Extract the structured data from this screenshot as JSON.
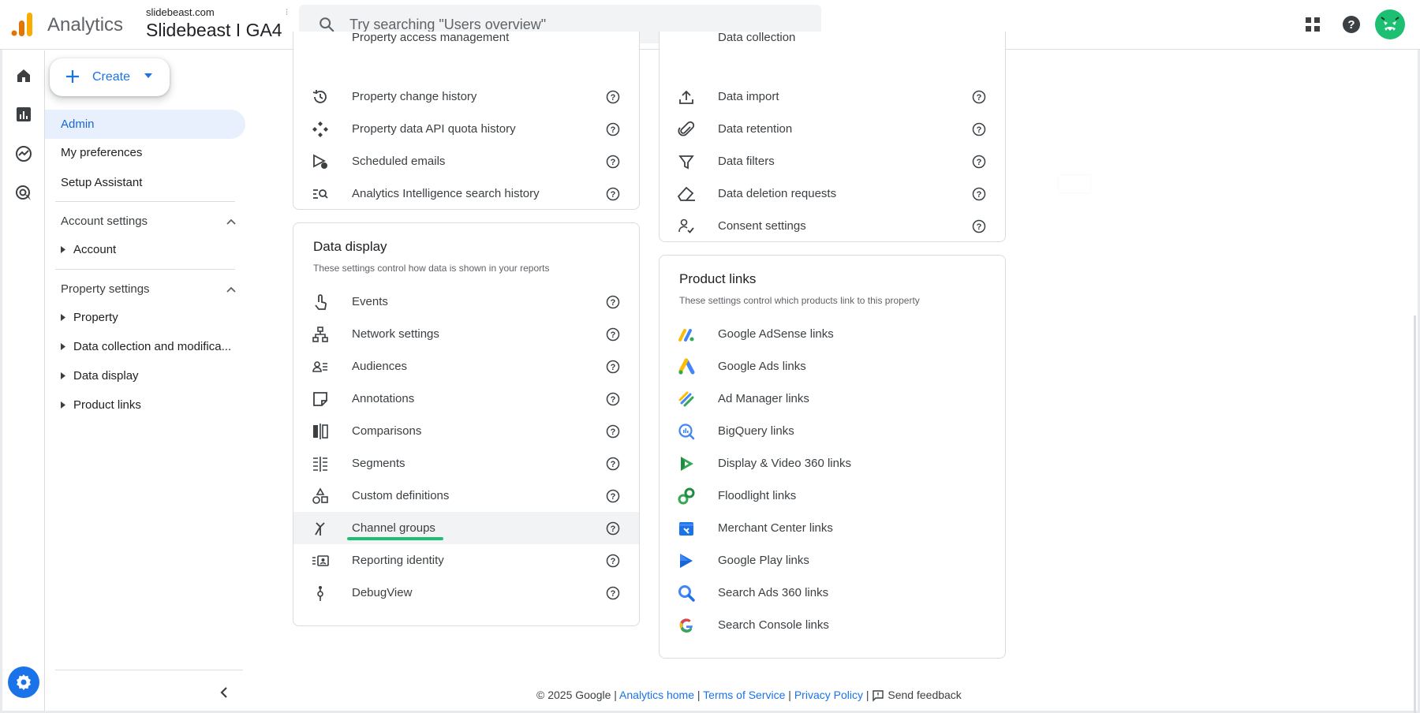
{
  "header": {
    "app_name": "Analytics",
    "account_domain": "slidebeast.com",
    "property_name": "Slidebeast I GA4",
    "search_placeholder": "Try searching \"Users overview\""
  },
  "colors": {
    "accent": "#1a73e8",
    "avatar": "#1dbf73",
    "highlight_underline": "#1dbf73"
  },
  "rail": {
    "items": [
      "home-icon",
      "reports-icon",
      "explore-icon",
      "advertising-icon"
    ],
    "admin": "gear-icon"
  },
  "nav": {
    "create_label": "Create",
    "items": [
      {
        "label": "Admin",
        "active": true
      },
      {
        "label": "My preferences",
        "active": false
      },
      {
        "label": "Setup Assistant",
        "active": false
      }
    ],
    "account_settings": {
      "title": "Account settings",
      "children": [
        "Account"
      ]
    },
    "property_settings": {
      "title": "Property settings",
      "children": [
        "Property",
        "Data collection and modifica...",
        "Data display",
        "Product links"
      ]
    }
  },
  "property_card": {
    "partial_top": "Property access management",
    "rows": [
      {
        "label": "Property change history",
        "icon": "history-icon"
      },
      {
        "label": "Property data API quota history",
        "icon": "api-quota-icon"
      },
      {
        "label": "Scheduled emails",
        "icon": "scheduled-email-icon"
      },
      {
        "label": "Analytics Intelligence search history",
        "icon": "search-history-icon"
      }
    ]
  },
  "data_display_card": {
    "title": "Data display",
    "subtitle": "These settings control how data is shown in your reports",
    "rows": [
      {
        "label": "Events",
        "icon": "touch-icon"
      },
      {
        "label": "Network settings",
        "icon": "network-icon"
      },
      {
        "label": "Audiences",
        "icon": "audiences-icon"
      },
      {
        "label": "Annotations",
        "icon": "annotation-icon"
      },
      {
        "label": "Comparisons",
        "icon": "comparison-icon"
      },
      {
        "label": "Segments",
        "icon": "segments-icon"
      },
      {
        "label": "Custom definitions",
        "icon": "shapes-icon"
      },
      {
        "label": "Channel groups",
        "icon": "merge-icon",
        "highlighted": true
      },
      {
        "label": "Reporting identity",
        "icon": "identity-icon"
      },
      {
        "label": "DebugView",
        "icon": "debug-icon"
      }
    ]
  },
  "data_collection_card": {
    "partial_top": "Data collection",
    "rows": [
      {
        "label": "Data import",
        "icon": "upload-icon"
      },
      {
        "label": "Data retention",
        "icon": "retention-icon"
      },
      {
        "label": "Data filters",
        "icon": "filter-icon"
      },
      {
        "label": "Data deletion requests",
        "icon": "eraser-icon"
      },
      {
        "label": "Consent settings",
        "icon": "consent-icon"
      }
    ]
  },
  "product_links_card": {
    "title": "Product links",
    "subtitle": "These settings control which products link to this property",
    "rows": [
      {
        "label": "Google AdSense links",
        "icon": "adsense-icon"
      },
      {
        "label": "Google Ads links",
        "icon": "google-ads-icon"
      },
      {
        "label": "Ad Manager links",
        "icon": "ad-manager-icon"
      },
      {
        "label": "BigQuery links",
        "icon": "bigquery-icon"
      },
      {
        "label": "Display & Video 360 links",
        "icon": "dv360-icon"
      },
      {
        "label": "Floodlight links",
        "icon": "floodlight-icon"
      },
      {
        "label": "Merchant Center links",
        "icon": "merchant-center-icon"
      },
      {
        "label": "Google Play links",
        "icon": "google-play-icon"
      },
      {
        "label": "Search Ads 360 links",
        "icon": "search-ads-360-icon"
      },
      {
        "label": "Search Console links",
        "icon": "google-g-icon"
      }
    ]
  },
  "footer": {
    "copyright": "© 2025 Google |",
    "analytics_home": "Analytics home",
    "terms": "Terms of Service",
    "privacy": "Privacy Policy",
    "feedback": "Send feedback",
    "sep": "|"
  }
}
